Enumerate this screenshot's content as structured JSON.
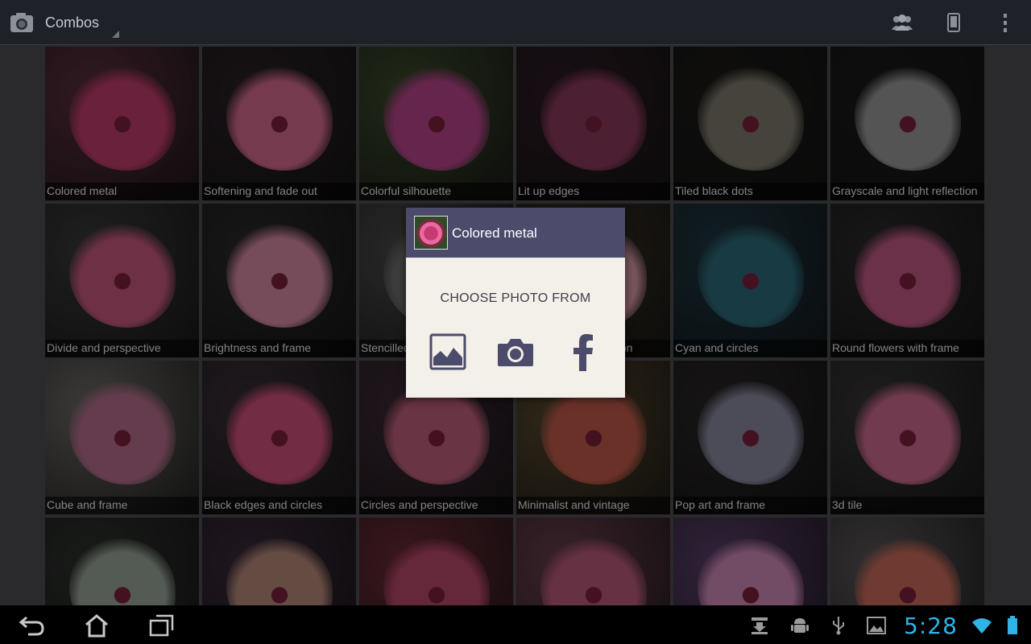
{
  "app": {
    "title": "Combos"
  },
  "tiles": [
    {
      "label": "Colored metal",
      "bg": "#5a2f3c",
      "rose": "#c23c6c",
      "row": 0,
      "col": 0
    },
    {
      "label": "Softening and fade out",
      "bg": "#2a2126",
      "rose": "#d56b8c",
      "row": 0,
      "col": 1
    },
    {
      "label": "Colorful silhouette",
      "bg": "#3b4a2c",
      "rose": "#b8448a",
      "row": 0,
      "col": 2
    },
    {
      "label": "Lit up edges",
      "bg": "#2c1b24",
      "rose": "#8d3a5c",
      "row": 0,
      "col": 3
    },
    {
      "label": "Tiled black dots",
      "bg": "#1c1a18",
      "rose": "#7e7a6c",
      "row": 0,
      "col": 4
    },
    {
      "label": "Grayscale and light reflection",
      "bg": "#1a1a1a",
      "rose": "#9a9a9a",
      "row": 0,
      "col": 5
    },
    {
      "label": "Divide and perspective",
      "bg": "#3a3a3a",
      "rose": "#c6587e",
      "row": 1,
      "col": 0
    },
    {
      "label": "Brightness and frame",
      "bg": "#2a2a2a",
      "rose": "#d88aa6",
      "row": 1,
      "col": 1
    },
    {
      "label": "Stencilled",
      "bg": "#4a4a4a",
      "rose": "#6e6e6e",
      "row": 1,
      "col": 2
    },
    {
      "label": "Rainbow and reflection",
      "bg": "#3d3326",
      "rose": "#d89aa8",
      "row": 1,
      "col": 3
    },
    {
      "label": "Cyan and circles",
      "bg": "#1e3642",
      "rose": "#2c6a7a",
      "row": 1,
      "col": 4
    },
    {
      "label": "Round flowers with frame",
      "bg": "#2c2a2c",
      "rose": "#c25a86",
      "row": 1,
      "col": 5
    },
    {
      "label": "Cube and frame",
      "bg": "#6d6a66",
      "rose": "#b86e8c",
      "row": 2,
      "col": 0
    },
    {
      "label": "Black edges and circles",
      "bg": "#3a2e36",
      "rose": "#d0507a",
      "row": 2,
      "col": 1
    },
    {
      "label": "Circles and perspective",
      "bg": "#3d2a36",
      "rose": "#c0607a",
      "row": 2,
      "col": 2
    },
    {
      "label": "Minimalist and vintage",
      "bg": "#5a4a2e",
      "rose": "#c05a4a",
      "row": 2,
      "col": 3
    },
    {
      "label": "Pop art and frame",
      "bg": "#2a2626",
      "rose": "#8a8aa2",
      "row": 2,
      "col": 4
    },
    {
      "label": "3d tile",
      "bg": "#393636",
      "rose": "#d06a90",
      "row": 2,
      "col": 5
    },
    {
      "label": "",
      "bg": "#2e322e",
      "rose": "#9aa69a",
      "row": 3,
      "col": 0
    },
    {
      "label": "",
      "bg": "#3a2a3a",
      "rose": "#b78a7a",
      "row": 3,
      "col": 1
    },
    {
      "label": "",
      "bg": "#6a2a36",
      "rose": "#b8486a",
      "row": 3,
      "col": 2
    },
    {
      "label": "",
      "bg": "#6a3e4e",
      "rose": "#b85a7a",
      "row": 3,
      "col": 3
    },
    {
      "label": "",
      "bg": "#5a3e6a",
      "rose": "#d08ab8",
      "row": 3,
      "col": 4
    },
    {
      "label": "",
      "bg": "#5a5656",
      "rose": "#c86a5a",
      "row": 3,
      "col": 5
    }
  ],
  "dialog": {
    "title": "Colored metal",
    "subtitle": "CHOOSE PHOTO FROM",
    "options": [
      "gallery-icon",
      "camera-icon",
      "facebook-icon"
    ]
  },
  "actionbar_icons": [
    "people-icon",
    "phone-icon",
    "overflow-menu-icon"
  ],
  "navbar": {
    "clock": "5:28",
    "accent": "#2fb4e6",
    "status_icons": [
      "download-icon",
      "android-debug-icon",
      "usb-icon",
      "image-icon",
      "wifi-icon",
      "battery-icon"
    ]
  }
}
